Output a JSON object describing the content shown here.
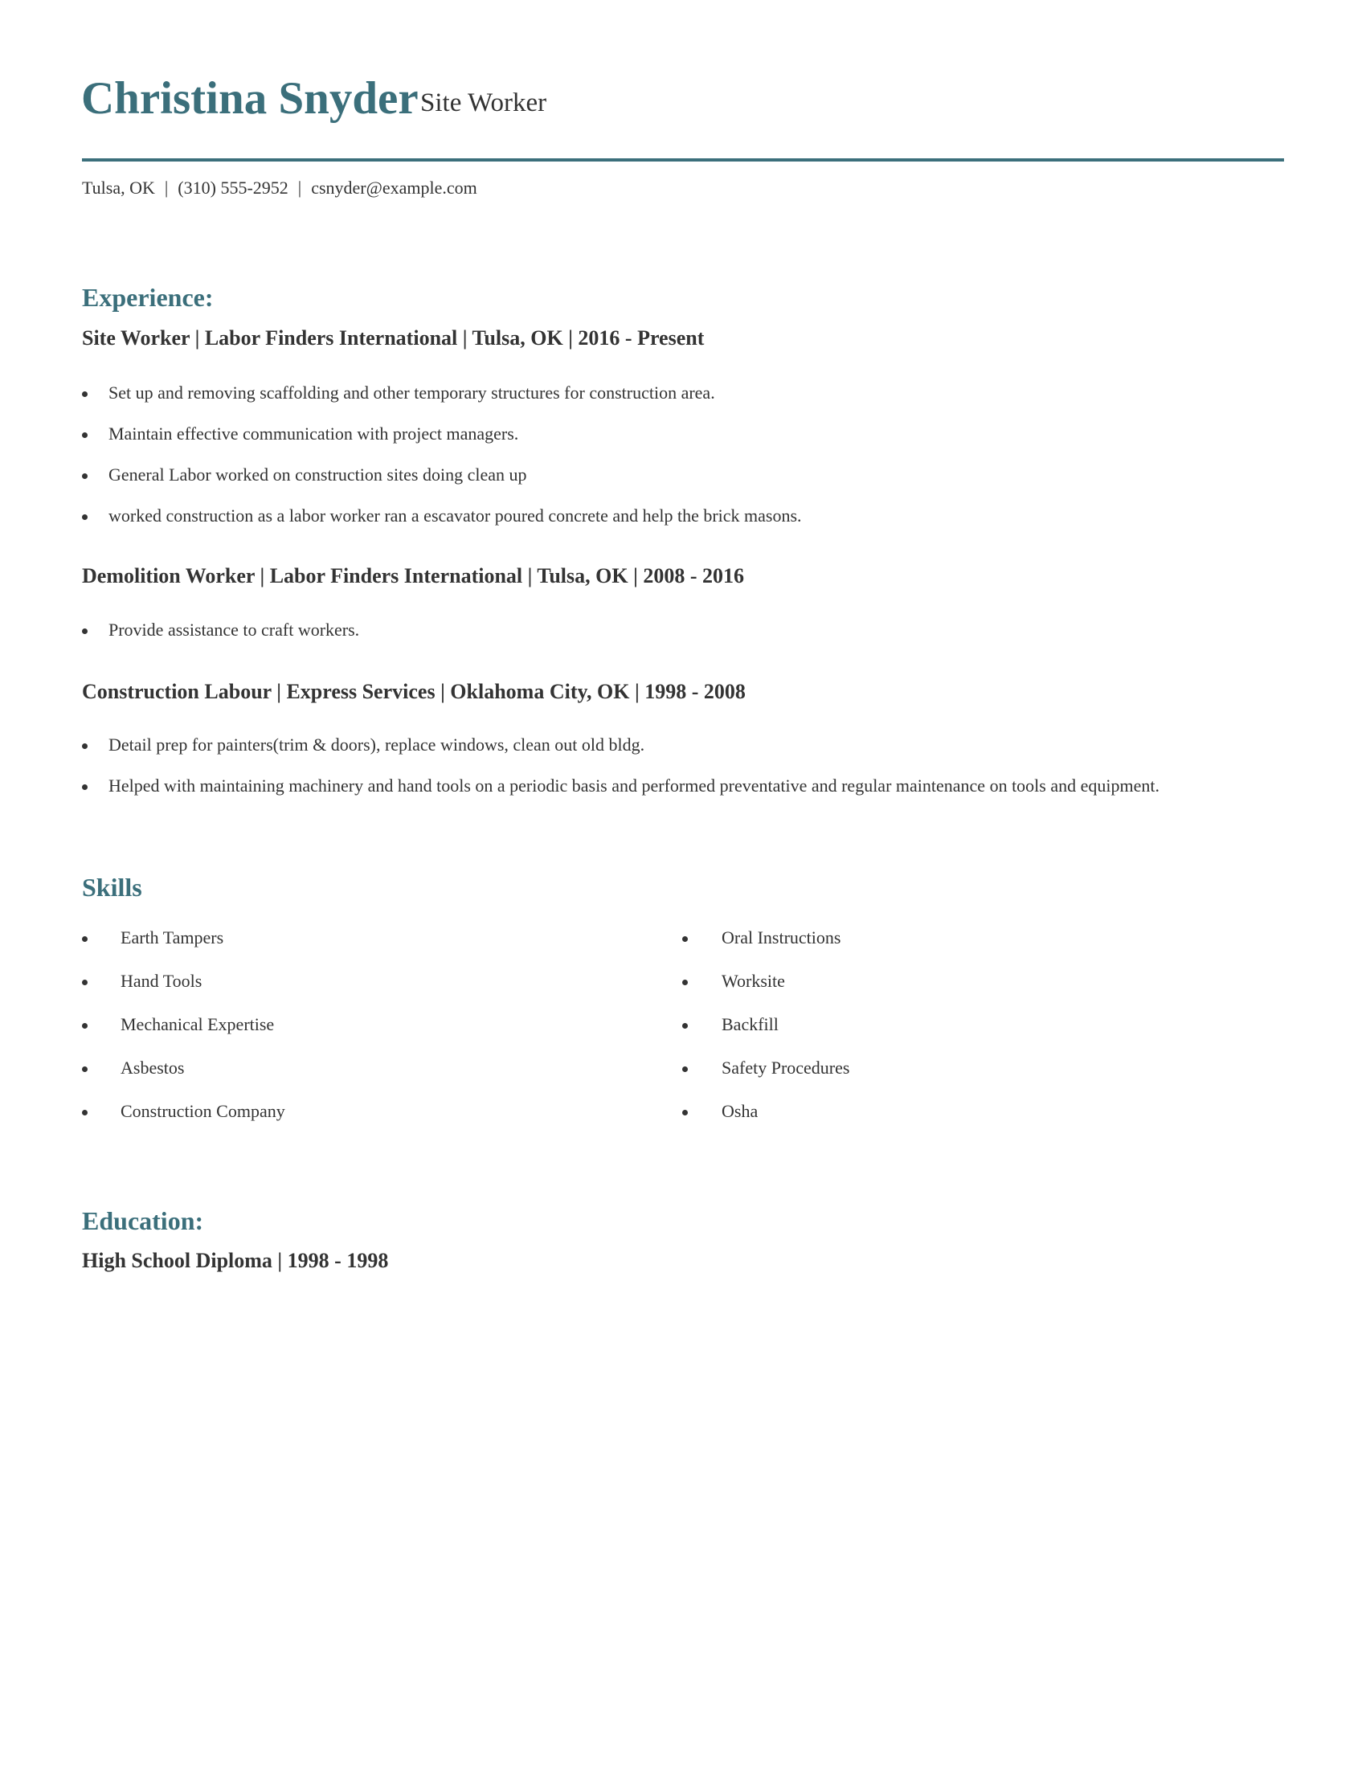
{
  "header": {
    "name": "Christina Snyder",
    "job_title": "Site Worker",
    "accent_color": "#3b6f7b",
    "contact": {
      "location": "Tulsa, OK",
      "phone": "(310) 555-2952",
      "email": "csnyder@example.com",
      "separator": "|"
    }
  },
  "experience": {
    "heading": "Experience:",
    "jobs": [
      {
        "title_line": "Site Worker | Labor Finders International | Tulsa, OK |  2016 - Present",
        "bullets": [
          "Set up and removing scaffolding and other temporary structures for construction area.",
          "Maintain effective communication with project managers.",
          "General Labor worked on construction sites doing clean up",
          "worked construction as a labor worker ran a escavator poured concrete and help the brick masons."
        ]
      },
      {
        "title_line": "Demolition Worker | Labor Finders International | Tulsa, OK |  2008 - 2016",
        "bullets": [
          "Provide assistance to craft workers."
        ]
      },
      {
        "title_line": "Construction Labour | Express Services | Oklahoma City, OK |  1998 - 2008",
        "bullets": [
          "Detail prep for painters(trim & doors), replace windows, clean out old bldg.",
          "Helped with maintaining machinery and hand tools on a periodic basis and performed preventative and regular maintenance on tools and equipment."
        ]
      }
    ]
  },
  "skills": {
    "heading": "Skills",
    "left": [
      "Earth Tampers",
      "Hand Tools",
      "Mechanical Expertise",
      "Asbestos",
      "Construction Company"
    ],
    "right": [
      "Oral Instructions",
      "Worksite",
      "Backfill",
      "Safety Procedures",
      "Osha"
    ]
  },
  "education": {
    "heading": "Education:",
    "entries": [
      {
        "title_line": "High School Diploma |  1998 - 1998"
      }
    ]
  }
}
